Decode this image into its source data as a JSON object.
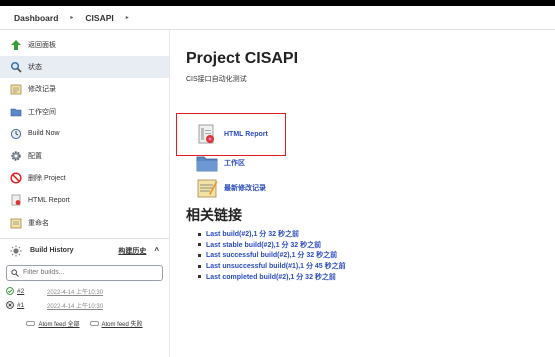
{
  "breadcrumb": {
    "items": [
      "Dashboard",
      "CISAPI"
    ]
  },
  "sidebar": {
    "items": [
      {
        "label": "返回面板",
        "icon": "arrow-up-icon"
      },
      {
        "label": "状态",
        "icon": "search-icon"
      },
      {
        "label": "修改记录",
        "icon": "notepad-icon"
      },
      {
        "label": "工作空间",
        "icon": "folder-icon"
      },
      {
        "label": "Build Now",
        "icon": "clock-icon"
      },
      {
        "label": "配置",
        "icon": "gear-icon"
      },
      {
        "label": "删除 Project",
        "icon": "no-entry-icon"
      },
      {
        "label": "HTML Report",
        "icon": "report-icon"
      },
      {
        "label": "重命名",
        "icon": "notepad-icon"
      }
    ]
  },
  "build_history": {
    "title": "Build History",
    "trend_label": "构建历史",
    "filter_placeholder": "Filter builds...",
    "builds": [
      {
        "number": "#2",
        "date": "2022-4-14 上午10:30",
        "status": "success"
      },
      {
        "number": "#1",
        "date": "2022-4-14 上午10:30",
        "status": "failure"
      }
    ],
    "atom_all": "Atom feed 全部",
    "atom_fail": "Atom feed 失败"
  },
  "main": {
    "title": "Project CISAPI",
    "description": "CIS接口自动化测试",
    "links": [
      {
        "label": "HTML Report",
        "icon": "report-icon"
      },
      {
        "label": "工作区",
        "icon": "folder-icon"
      },
      {
        "label": "最新修改记录",
        "icon": "notepad-icon"
      }
    ],
    "related_title": "相关链接",
    "related_links": [
      "Last build(#2),1 分 32 秒之前",
      "Last stable build(#2),1 分 32 秒之前",
      "Last successful build(#2),1 分 32 秒之前",
      "Last unsuccessful build(#1),1 分 45 秒之前",
      "Last completed build(#2),1 分 32 秒之前"
    ]
  },
  "colors": {
    "link": "#2a4bbf",
    "highlight": "#e01b24",
    "active_bg": "#e8ecf3"
  }
}
